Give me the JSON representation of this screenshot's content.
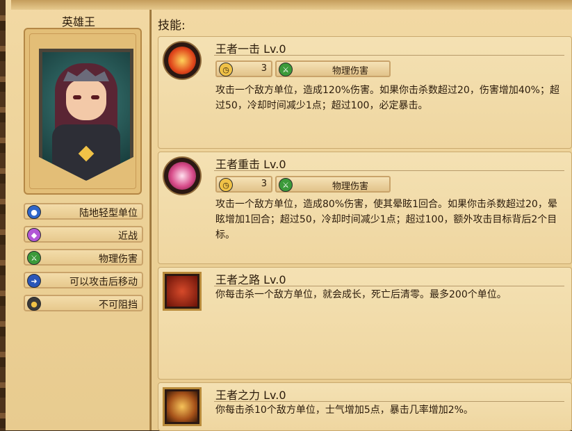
{
  "hero": {
    "name": "英雄王",
    "tags": [
      {
        "icon": "unit-type-icon",
        "label": "陆地轻型单位",
        "color": "#2f66c9"
      },
      {
        "icon": "melee-icon",
        "label": "近战",
        "color": "#b257d6"
      },
      {
        "icon": "sword-icon",
        "label": "物理伤害",
        "color": "#3c9a3a"
      },
      {
        "icon": "move-icon",
        "label": "可以攻击后移动",
        "color": "#2b56b8"
      },
      {
        "icon": "unstoppable-icon",
        "label": "不可阻挡",
        "color": "#3a3a3a"
      }
    ]
  },
  "skills_title": "技能:",
  "skills": [
    {
      "name": "王者一击 Lv.0",
      "icon": "fire-slash-icon",
      "cooldown": "3",
      "damage_type": "物理伤害",
      "description": "攻击一个敌方单位，造成120%伤害。如果你击杀数超过20，伤害增加40%；超过50，冷却时间减少1点；超过100，必定暴击。"
    },
    {
      "name": "王者重击 Lv.0",
      "icon": "heavy-strike-icon",
      "cooldown": "3",
      "damage_type": "物理伤害",
      "description": "攻击一个敌方单位，造成80%伤害，使其晕眩1回合。如果你击杀数超过20，晕眩增加1回合；超过50，冷却时间减少1点；超过100，额外攻击目标背后2个目标。"
    },
    {
      "name": "王者之路 Lv.0",
      "icon": "crown-path-icon",
      "description": "你每击杀一个敌方单位，就会成长，死亡后清零。最多200个单位。"
    },
    {
      "name": "王者之力 Lv.0",
      "icon": "armor-power-icon",
      "description": "你每击杀10个敌方单位，士气增加5点，暴击几率增加2%。"
    }
  ]
}
